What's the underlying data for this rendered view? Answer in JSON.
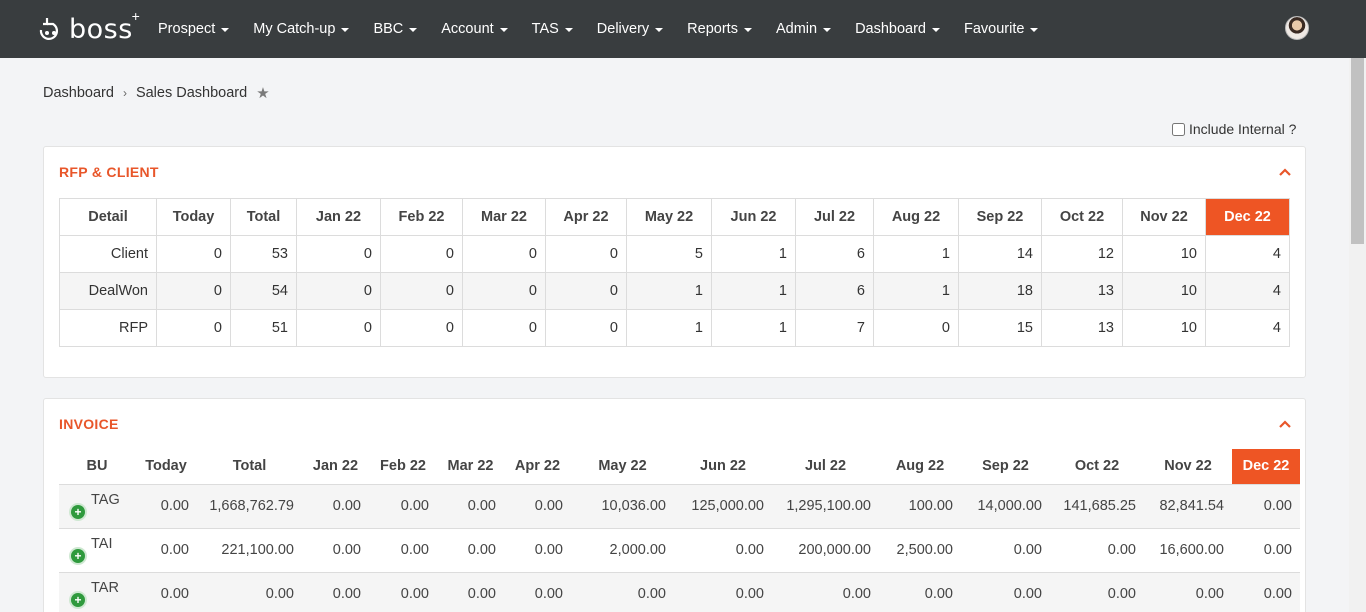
{
  "app": {
    "logo_text": "boss"
  },
  "nav": {
    "items": [
      {
        "label": "Prospect"
      },
      {
        "label": "My Catch-up"
      },
      {
        "label": "BBC"
      },
      {
        "label": "Account"
      },
      {
        "label": "TAS"
      },
      {
        "label": "Delivery"
      },
      {
        "label": "Reports"
      },
      {
        "label": "Admin"
      },
      {
        "label": "Dashboard"
      },
      {
        "label": "Favourite"
      }
    ]
  },
  "breadcrumb": {
    "parent": "Dashboard",
    "current": "Sales Dashboard"
  },
  "include_internal": {
    "label": "Include Internal ?",
    "checked": false
  },
  "colors": {
    "accent": "#ee5524",
    "nav_bg": "#393d3f",
    "plus_green": "#2f9a3d"
  },
  "rfp_panel": {
    "title": "RFP & CLIENT",
    "headers": [
      "Detail",
      "Today",
      "Total",
      "Jan 22",
      "Feb 22",
      "Mar 22",
      "Apr 22",
      "May 22",
      "Jun 22",
      "Jul 22",
      "Aug 22",
      "Sep 22",
      "Oct 22",
      "Nov 22",
      "Dec 22"
    ],
    "rows": [
      [
        "Client",
        "0",
        "53",
        "0",
        "0",
        "0",
        "0",
        "5",
        "1",
        "6",
        "1",
        "14",
        "12",
        "10",
        "4"
      ],
      [
        "DealWon",
        "0",
        "54",
        "0",
        "0",
        "0",
        "0",
        "1",
        "1",
        "6",
        "1",
        "18",
        "13",
        "10",
        "4"
      ],
      [
        "RFP",
        "0",
        "51",
        "0",
        "0",
        "0",
        "0",
        "1",
        "1",
        "7",
        "0",
        "15",
        "13",
        "10",
        "4"
      ]
    ]
  },
  "invoice_panel": {
    "title": "INVOICE",
    "headers": [
      "BU",
      "Today",
      "Total",
      "Jan 22",
      "Feb 22",
      "Mar 22",
      "Apr 22",
      "May 22",
      "Jun 22",
      "Jul 22",
      "Aug 22",
      "Sep 22",
      "Oct 22",
      "Nov 22",
      "Dec 22"
    ],
    "rows": [
      [
        "TAG",
        "0.00",
        "1,668,762.79",
        "0.00",
        "0.00",
        "0.00",
        "0.00",
        "10,036.00",
        "125,000.00",
        "1,295,100.00",
        "100.00",
        "14,000.00",
        "141,685.25",
        "82,841.54",
        "0.00"
      ],
      [
        "TAI",
        "0.00",
        "221,100.00",
        "0.00",
        "0.00",
        "0.00",
        "0.00",
        "2,000.00",
        "0.00",
        "200,000.00",
        "2,500.00",
        "0.00",
        "0.00",
        "16,600.00",
        "0.00"
      ],
      [
        "TAR",
        "0.00",
        "0.00",
        "0.00",
        "0.00",
        "0.00",
        "0.00",
        "0.00",
        "0.00",
        "0.00",
        "0.00",
        "0.00",
        "0.00",
        "0.00",
        "0.00"
      ]
    ]
  }
}
